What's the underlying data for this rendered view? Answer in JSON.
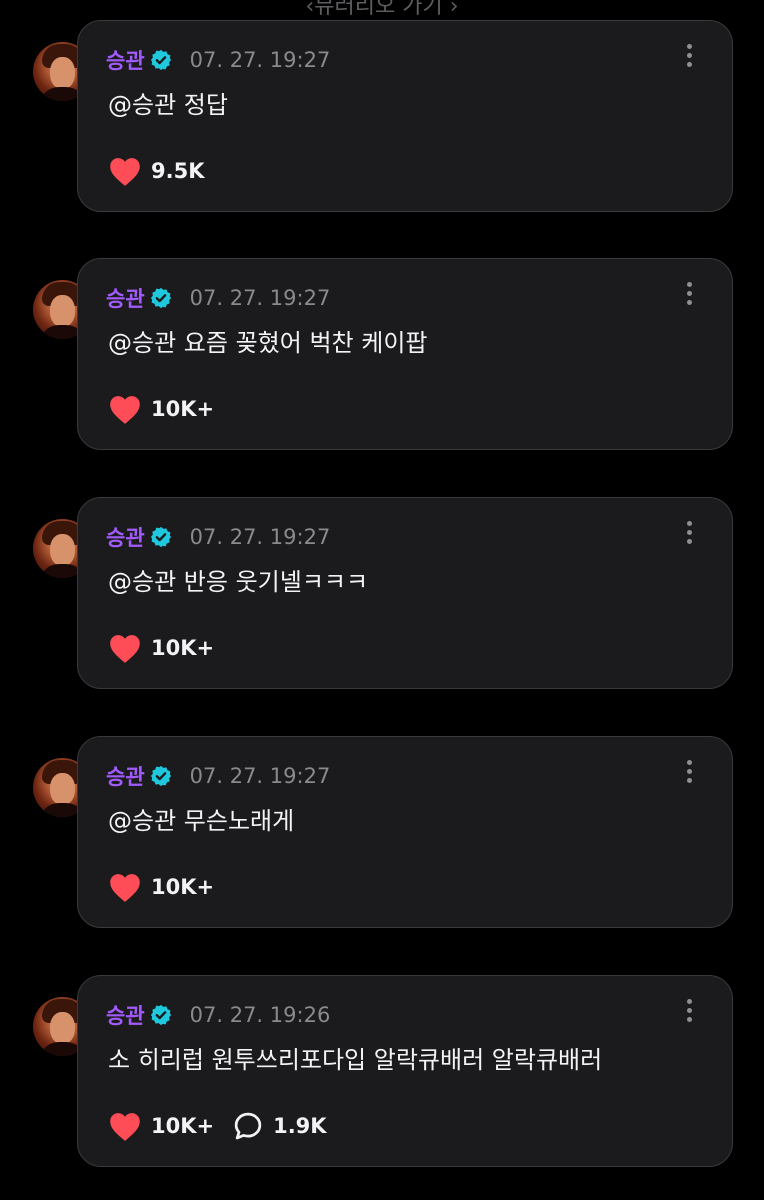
{
  "top_link": "‹뮤러리오 가기 ›",
  "colors": {
    "username": "#a25bfd",
    "verified": "#1fc8dc",
    "heart": "#ff4d57",
    "card_bg": "#1b1b1d"
  },
  "posts": [
    {
      "username": "승관",
      "timestamp": "07. 27. 19:27",
      "text": "@승관 정답",
      "likes": "9.5K",
      "comments": ""
    },
    {
      "username": "승관",
      "timestamp": "07. 27. 19:27",
      "text": "@승관 요즘 꽂혔어 벅찬 케이팝",
      "likes": "10K+",
      "comments": ""
    },
    {
      "username": "승관",
      "timestamp": "07. 27. 19:27",
      "text": "@승관 반응 웃기넬ㅋㅋㅋ",
      "likes": "10K+",
      "comments": ""
    },
    {
      "username": "승관",
      "timestamp": "07. 27. 19:27",
      "text": "@승관 무슨노래게",
      "likes": "10K+",
      "comments": ""
    },
    {
      "username": "승관",
      "timestamp": "07. 27. 19:26",
      "text": "소 히리럽 원투쓰리포다입 알락큐배러 알락큐배러",
      "likes": "10K+",
      "comments": "1.9K"
    }
  ]
}
